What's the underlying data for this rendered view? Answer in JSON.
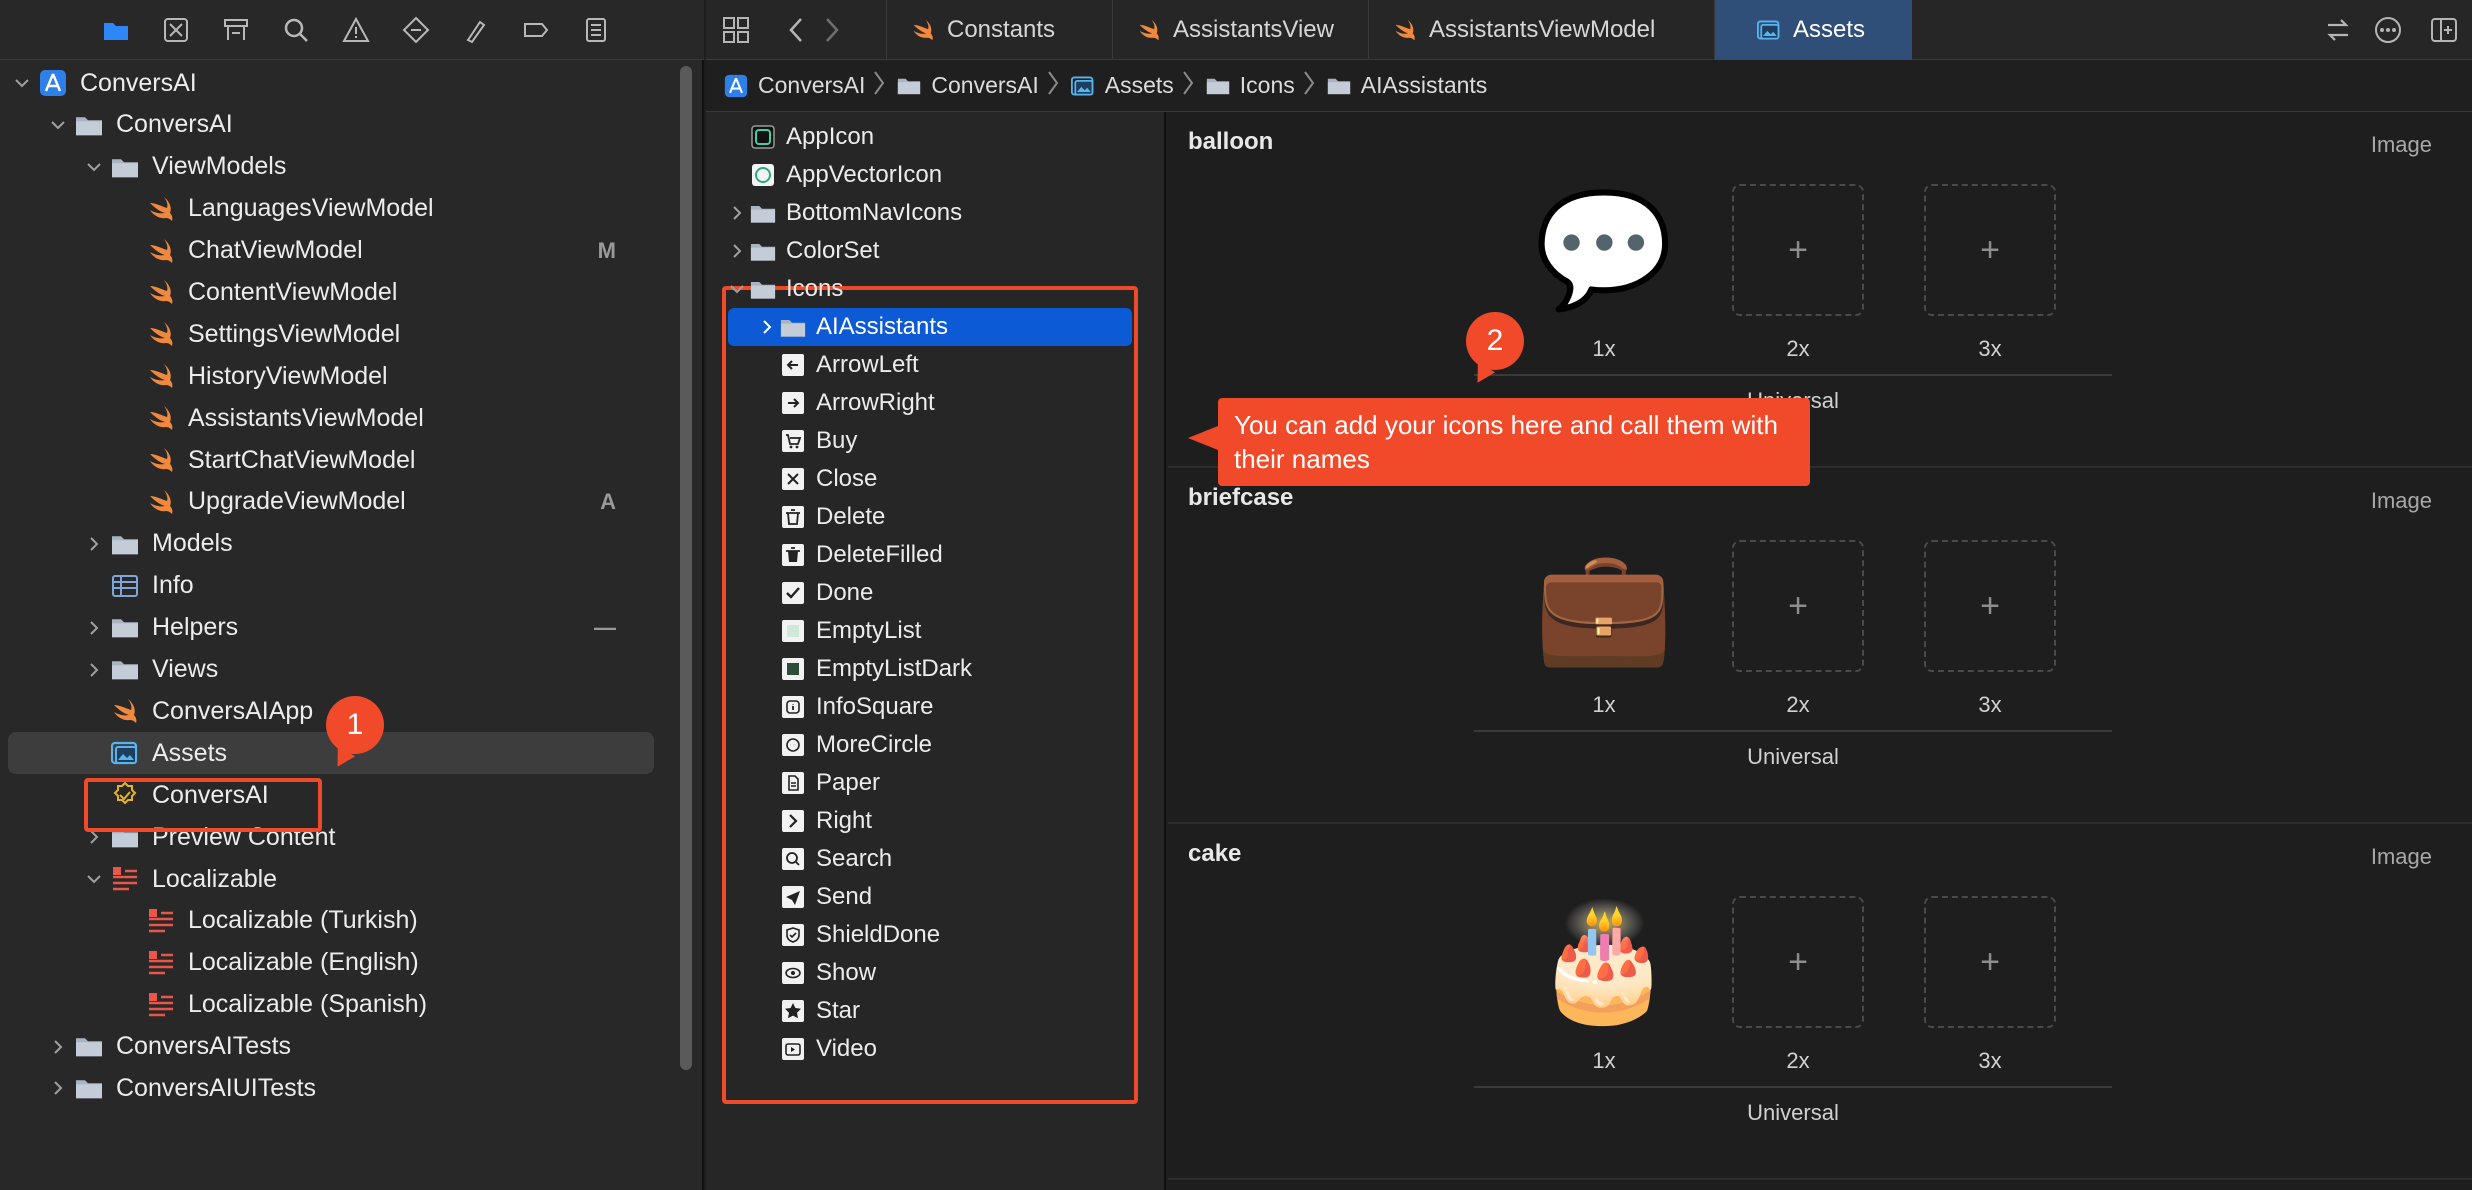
{
  "navigator": {
    "toolbar_icons": [
      "folder-icon",
      "source-control-icon",
      "symbol-icon",
      "search-icon",
      "warning-icon",
      "test-icon",
      "debug-icon",
      "breakpoint-icon",
      "report-icon"
    ],
    "tree": [
      {
        "label": "ConversAI",
        "level": 0,
        "icon": "project",
        "disclosure": "open"
      },
      {
        "label": "ConversAI",
        "level": 1,
        "icon": "folder",
        "disclosure": "open"
      },
      {
        "label": "ViewModels",
        "level": 2,
        "icon": "folder",
        "disclosure": "open"
      },
      {
        "label": "LanguagesViewModel",
        "level": 3,
        "icon": "swift",
        "disclosure": ""
      },
      {
        "label": "ChatViewModel",
        "level": 3,
        "icon": "swift",
        "disclosure": "",
        "badge": "M"
      },
      {
        "label": "ContentViewModel",
        "level": 3,
        "icon": "swift",
        "disclosure": ""
      },
      {
        "label": "SettingsViewModel",
        "level": 3,
        "icon": "swift",
        "disclosure": ""
      },
      {
        "label": "HistoryViewModel",
        "level": 3,
        "icon": "swift",
        "disclosure": ""
      },
      {
        "label": "AssistantsViewModel",
        "level": 3,
        "icon": "swift",
        "disclosure": ""
      },
      {
        "label": "StartChatViewModel",
        "level": 3,
        "icon": "swift",
        "disclosure": ""
      },
      {
        "label": "UpgradeViewModel",
        "level": 3,
        "icon": "swift",
        "disclosure": "",
        "badge": "A"
      },
      {
        "label": "Models",
        "level": 2,
        "icon": "folder",
        "disclosure": "closed"
      },
      {
        "label": "Info",
        "level": 2,
        "icon": "plist",
        "disclosure": ""
      },
      {
        "label": "Helpers",
        "level": 2,
        "icon": "folder",
        "disclosure": "closed",
        "badge": "—"
      },
      {
        "label": "Views",
        "level": 2,
        "icon": "folder",
        "disclosure": "closed"
      },
      {
        "label": "ConversAIApp",
        "level": 2,
        "icon": "swift",
        "disclosure": ""
      },
      {
        "label": "Assets",
        "level": 2,
        "icon": "assets",
        "disclosure": "",
        "selected": true
      },
      {
        "label": "ConversAI",
        "level": 2,
        "icon": "entitlements",
        "disclosure": ""
      },
      {
        "label": "Preview Content",
        "level": 2,
        "icon": "folder",
        "disclosure": "closed"
      },
      {
        "label": "Localizable",
        "level": 2,
        "icon": "strings",
        "disclosure": "open"
      },
      {
        "label": "Localizable (Turkish)",
        "level": 3,
        "icon": "strings",
        "disclosure": ""
      },
      {
        "label": "Localizable (English)",
        "level": 3,
        "icon": "strings",
        "disclosure": ""
      },
      {
        "label": "Localizable (Spanish)",
        "level": 3,
        "icon": "strings",
        "disclosure": ""
      },
      {
        "label": "ConversAITests",
        "level": 1,
        "icon": "folder",
        "disclosure": "closed"
      },
      {
        "label": "ConversAIUITests",
        "level": 1,
        "icon": "folder",
        "disclosure": "closed"
      }
    ],
    "callout_number": "1"
  },
  "editor": {
    "tabs": [
      {
        "label": "Constants",
        "icon": "swift",
        "active": false
      },
      {
        "label": "AssistantsView",
        "icon": "swift",
        "active": false
      },
      {
        "label": "AssistantsViewModel",
        "icon": "swift",
        "active": false
      },
      {
        "label": "Assets",
        "icon": "assets",
        "active": true
      }
    ],
    "breadcrumbs": [
      {
        "label": "ConversAI",
        "icon": "project"
      },
      {
        "label": "ConversAI",
        "icon": "folder"
      },
      {
        "label": "Assets",
        "icon": "assets"
      },
      {
        "label": "Icons",
        "icon": "folder"
      },
      {
        "label": "AIAssistants",
        "icon": "folder"
      }
    ],
    "asset_list": [
      {
        "label": "AppIcon",
        "level": 0,
        "icon": "appicon",
        "disclosure": ""
      },
      {
        "label": "AppVectorIcon",
        "level": 0,
        "icon": "vectoricon",
        "disclosure": ""
      },
      {
        "label": "BottomNavIcons",
        "level": 0,
        "icon": "folder",
        "disclosure": "closed"
      },
      {
        "label": "ColorSet",
        "level": 0,
        "icon": "folder",
        "disclosure": "closed"
      },
      {
        "label": "Icons",
        "level": 0,
        "icon": "folder",
        "disclosure": "open"
      },
      {
        "label": "AIAssistants",
        "level": 1,
        "icon": "folder",
        "disclosure": "closed",
        "selected": true
      },
      {
        "label": "ArrowLeft",
        "level": 1,
        "icon": "arrow-left",
        "disclosure": ""
      },
      {
        "label": "ArrowRight",
        "level": 1,
        "icon": "arrow-right",
        "disclosure": ""
      },
      {
        "label": "Buy",
        "level": 1,
        "icon": "cart",
        "disclosure": ""
      },
      {
        "label": "Close",
        "level": 1,
        "icon": "close",
        "disclosure": ""
      },
      {
        "label": "Delete",
        "level": 1,
        "icon": "trash",
        "disclosure": ""
      },
      {
        "label": "DeleteFilled",
        "level": 1,
        "icon": "trash-filled",
        "disclosure": ""
      },
      {
        "label": "Done",
        "level": 1,
        "icon": "check",
        "disclosure": ""
      },
      {
        "label": "EmptyList",
        "level": 1,
        "icon": "list",
        "disclosure": ""
      },
      {
        "label": "EmptyListDark",
        "level": 1,
        "icon": "list-dark",
        "disclosure": ""
      },
      {
        "label": "InfoSquare",
        "level": 1,
        "icon": "info",
        "disclosure": ""
      },
      {
        "label": "MoreCircle",
        "level": 1,
        "icon": "more",
        "disclosure": ""
      },
      {
        "label": "Paper",
        "level": 1,
        "icon": "paper",
        "disclosure": ""
      },
      {
        "label": "Right",
        "level": 1,
        "icon": "chevron",
        "disclosure": ""
      },
      {
        "label": "Search",
        "level": 1,
        "icon": "search",
        "disclosure": ""
      },
      {
        "label": "Send",
        "level": 1,
        "icon": "send",
        "disclosure": ""
      },
      {
        "label": "ShieldDone",
        "level": 1,
        "icon": "shield",
        "disclosure": ""
      },
      {
        "label": "Show",
        "level": 1,
        "icon": "eye",
        "disclosure": ""
      },
      {
        "label": "Star",
        "level": 1,
        "icon": "star",
        "disclosure": ""
      },
      {
        "label": "Video",
        "level": 1,
        "icon": "video",
        "disclosure": ""
      }
    ],
    "image_sets": [
      {
        "name": "balloon",
        "type": "Image",
        "emoji": "💬",
        "scales": [
          "1x",
          "2x",
          "3x"
        ],
        "universal": "Universal"
      },
      {
        "name": "briefcase",
        "type": "Image",
        "emoji": "💼",
        "scales": [
          "1x",
          "2x",
          "3x"
        ],
        "universal": "Universal"
      },
      {
        "name": "cake",
        "type": "Image",
        "emoji": "🎂",
        "scales": [
          "1x",
          "2x",
          "3x"
        ],
        "universal": "Universal"
      }
    ],
    "empty_slot_symbol": "+",
    "callout_number": "2",
    "tooltip": "You can add your icons here and call them with their names"
  },
  "colors": {
    "accent_callout": "#f04a2a",
    "selection": "#0c5ad6",
    "active_tab": "#2f4f78",
    "swift": "#f0883e",
    "folder": "#a9b4c2"
  }
}
